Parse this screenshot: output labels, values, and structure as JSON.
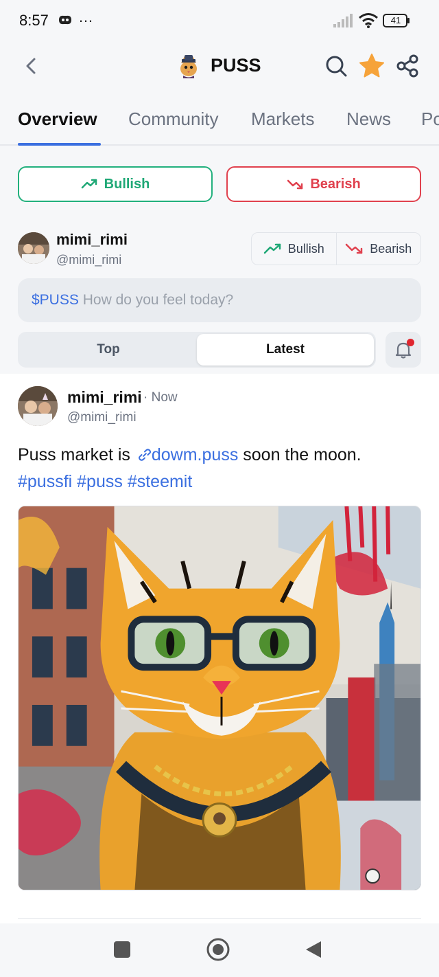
{
  "status_bar": {
    "time": "8:57",
    "more": "…",
    "battery": "41"
  },
  "header": {
    "title": "PUSS",
    "icons": [
      "back-arrow-icon",
      "puss-coin-logo",
      "search-icon",
      "star-icon",
      "share-icon"
    ],
    "star_color": "#f6a33a"
  },
  "tabs": [
    {
      "label": "Overview",
      "active": true
    },
    {
      "label": "Community",
      "active": false
    },
    {
      "label": "Markets",
      "active": false
    },
    {
      "label": "News",
      "active": false
    },
    {
      "label": "Po",
      "active": false
    }
  ],
  "sentiment": {
    "bullish_label": "Bullish",
    "bearish_label": "Bearish",
    "bullish_color": "#1fa876",
    "bearish_color": "#e0414e"
  },
  "composer": {
    "user_name": "mimi_rimi",
    "user_handle": "@mimi_rimi",
    "toggle_bullish": "Bullish",
    "toggle_bearish": "Bearish",
    "ticker": "$PUSS",
    "placeholder": "How do you feel today?"
  },
  "feed_filter": {
    "options": [
      "Top",
      "Latest"
    ],
    "selected": "Latest"
  },
  "post": {
    "author_name": "mimi_rimi",
    "time": "· Now",
    "author_handle": "@mimi_rimi",
    "text_before": "Puss market is ",
    "link_text": "dowm.puss",
    "text_after": " soon the moon.",
    "hashtags": "#pussfi #puss #steemit",
    "image_description_icon": "cat-artwork-image"
  },
  "accent_color": "#3b6fe0"
}
